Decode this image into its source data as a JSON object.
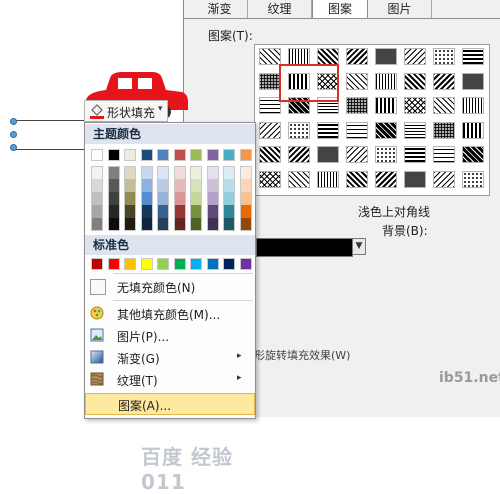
{
  "dialog": {
    "tabs": [
      "渐变",
      "纹理",
      "图案",
      "图片"
    ],
    "active_tab": "图案",
    "pattern_label": "图案(T):",
    "pattern_name": "浅色上对角线",
    "background_label": "背景(B):",
    "rotate_label": "形旋转填充效果(W)",
    "foreground_color": "#000000"
  },
  "fill_button": {
    "label": "形状填充",
    "arrow": "▾"
  },
  "menu": {
    "theme_header": "主题颜色",
    "standard_header": "标准色",
    "theme_colors": [
      "#ffffff",
      "#000000",
      "#eeece1",
      "#1f497d",
      "#4f81bd",
      "#c0504d",
      "#9bbb59",
      "#8064a2",
      "#4bacc6",
      "#f79646"
    ],
    "theme_shades": [
      [
        "#f2f2f2",
        "#d9d9d9",
        "#bfbfbf",
        "#a6a6a6",
        "#808080"
      ],
      [
        "#7f7f7f",
        "#595959",
        "#404040",
        "#262626",
        "#0d0d0d"
      ],
      [
        "#ddd9c3",
        "#c4bd97",
        "#948a54",
        "#4a452a",
        "#1e1c11"
      ],
      [
        "#c6d9f0",
        "#8db3e2",
        "#548dd4",
        "#17365d",
        "#0f243e"
      ],
      [
        "#dbe5f1",
        "#b8cce4",
        "#95b3d7",
        "#366092",
        "#244061"
      ],
      [
        "#f2dcdb",
        "#e5b9b7",
        "#d99694",
        "#953734",
        "#632423"
      ],
      [
        "#ebf1dd",
        "#d7e3bc",
        "#c3d69b",
        "#76923c",
        "#4f6128"
      ],
      [
        "#e5e0ec",
        "#ccc1d9",
        "#b2a2c7",
        "#5f497a",
        "#3f3151"
      ],
      [
        "#dbeef3",
        "#b7dde8",
        "#92cddc",
        "#31859b",
        "#205867"
      ],
      [
        "#fdeada",
        "#fbd5b5",
        "#fac08f",
        "#e36c09",
        "#974806"
      ]
    ],
    "standard_colors": [
      "#c00000",
      "#ff0000",
      "#ffc000",
      "#ffff00",
      "#92d050",
      "#00b050",
      "#00b0f0",
      "#0070c0",
      "#002060",
      "#7030a0"
    ],
    "items": [
      {
        "label": "无填充颜色(N)",
        "icon": "no-fill-icon",
        "submenu": false
      },
      {
        "label": "其他填充颜色(M)...",
        "icon": "color-palette-icon",
        "submenu": false
      },
      {
        "label": "图片(P)...",
        "icon": "picture-icon",
        "submenu": false
      },
      {
        "label": "渐变(G)",
        "icon": "gradient-icon",
        "submenu": true
      },
      {
        "label": "纹理(T)",
        "icon": "texture-icon",
        "submenu": true
      },
      {
        "label": "图案(A)...",
        "icon": "pattern-icon",
        "submenu": false
      }
    ],
    "submenu_arrow": "▸"
  },
  "watermarks": {
    "baidu": "百度 经验011",
    "site": "ib51.net"
  },
  "accent": {
    "selection": "#d93025",
    "hover": "#ffe8a0",
    "car": "#e8141c"
  }
}
